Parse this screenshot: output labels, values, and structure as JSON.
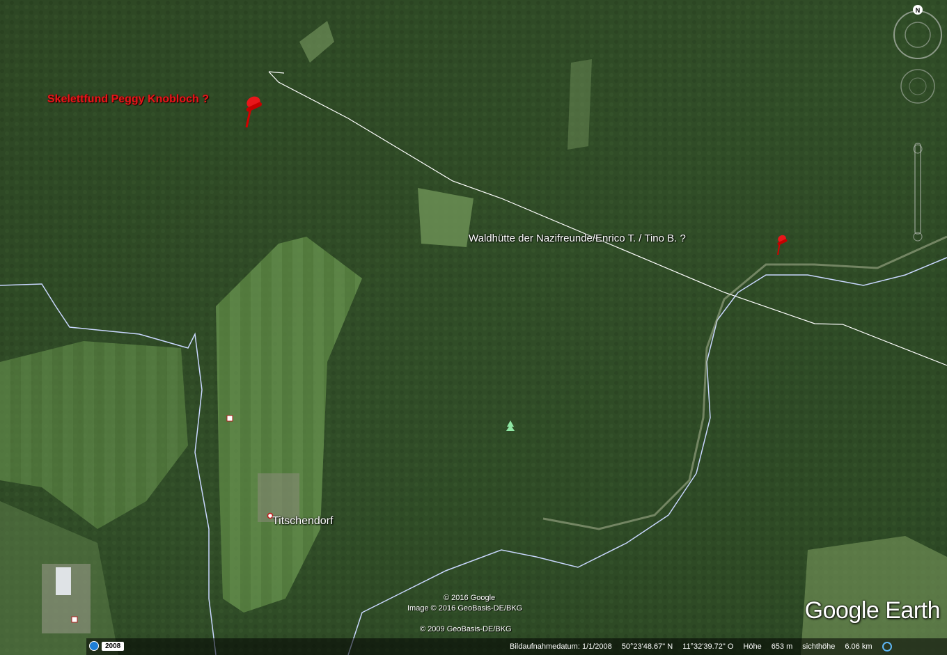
{
  "pins": [
    {
      "label": "Skelettfund Peggy Knobloch ?",
      "color": "#e8161a"
    },
    {
      "label": "Waldhütte der Nazifreunde/Enrico T. /  Tino B. ?",
      "color": "#e8161a"
    }
  ],
  "places": {
    "titschendorf": "Titschendorf"
  },
  "credits": {
    "google": "© 2016 Google",
    "image": "Image © 2016 GeoBasis-DE/BKG",
    "geobasis": "© 2009 GeoBasis-DE/BKG"
  },
  "brand": "Google Earth",
  "compass": {
    "north": "N"
  },
  "historical_year": "2008",
  "status": {
    "date_label": "Bildaufnahmedatum: 1/1/2008",
    "lat": "50°23'48.67\" N",
    "lon": "11°32'39.72\" O",
    "elevation_label": "Höhe",
    "elevation_value": "653 m",
    "eye_label": "sichthöhe",
    "eye_value": "6.06 km"
  },
  "colors": {
    "pin": "#e8161a",
    "border_line": "#c9d7ff",
    "path_line": "#ffffff"
  }
}
